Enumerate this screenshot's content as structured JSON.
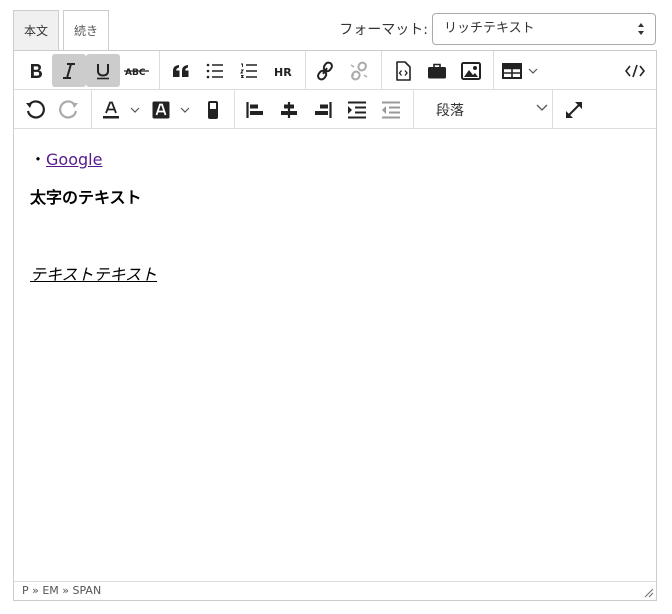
{
  "tabs": [
    {
      "label": "本文",
      "active": true
    },
    {
      "label": "続き",
      "active": false
    }
  ],
  "format": {
    "label": "フォーマット:",
    "selected": "リッチテキスト"
  },
  "toolbar": {
    "block_style": "段落"
  },
  "content": {
    "bullet": "・",
    "link_text": "Google ",
    "bold_text": "太字のテキスト",
    "italic_text": "テキストテキスト"
  },
  "statusbar": {
    "path": "P » EM » SPAN"
  },
  "colors": {
    "link": "#551a8b",
    "active_button": "#cccccc",
    "border": "#cccccc"
  }
}
